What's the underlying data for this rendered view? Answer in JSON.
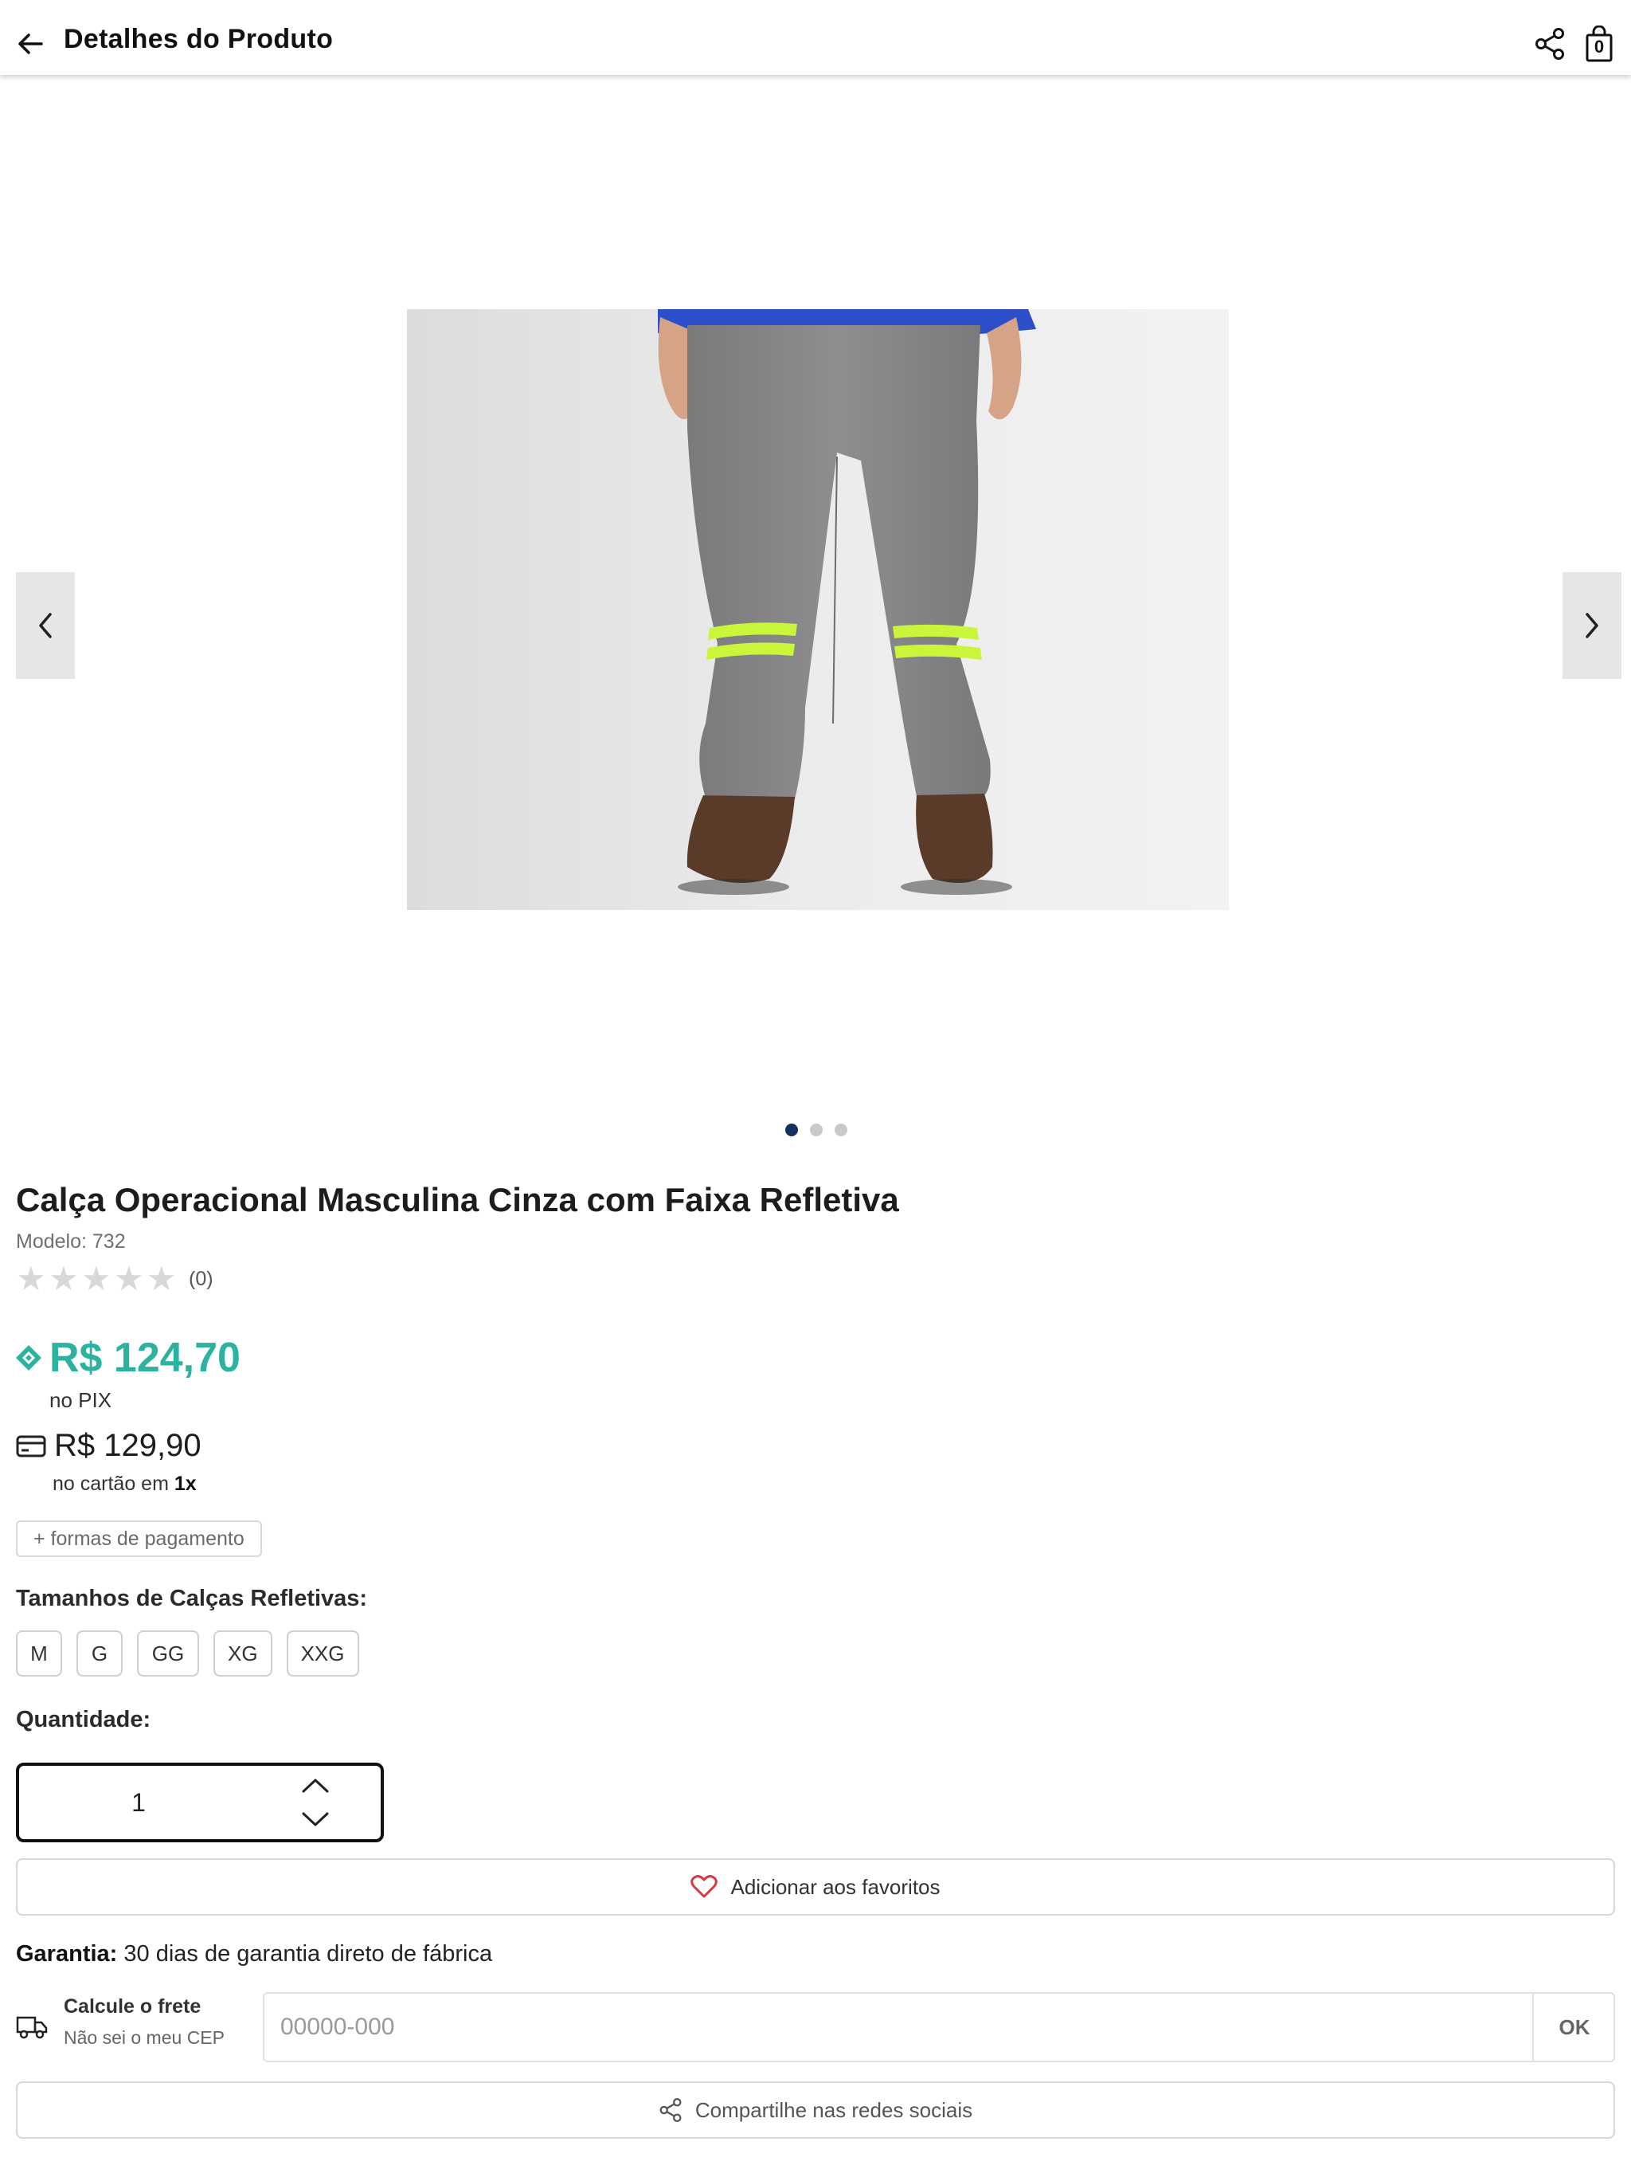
{
  "header": {
    "title": "Detalhes do Produto",
    "cart_count": "0"
  },
  "gallery": {
    "image_alt": "Calça Operacional Masculina Cinza com Faixa Refletiva",
    "dot_count": 3,
    "active_dot": 1
  },
  "product": {
    "title": "Calça Operacional Masculina Cinza com Faixa Refletiva",
    "model": "Modelo: 732",
    "rating_stars": 0,
    "rating_count": "(0)"
  },
  "pricing": {
    "pix_price": "R$ 124,70",
    "pix_label": "no PIX",
    "card_price": "R$ 129,90",
    "card_label_prefix": "no cartão em ",
    "card_installments": "1x",
    "payment_methods_label": "+ formas de pagamento"
  },
  "sizes": {
    "title": "Tamanhos de Calças Refletivas:",
    "options": [
      "M",
      "G",
      "GG",
      "XG",
      "XXG"
    ]
  },
  "quantity": {
    "title": "Quantidade:",
    "value": "1"
  },
  "favorites": {
    "label": "Adicionar aos favoritos"
  },
  "warranty": {
    "label": "Garantia:",
    "text": " 30 dias de garantia direto de fábrica"
  },
  "shipping": {
    "title": "Calcule o frete",
    "link": "Não sei o meu CEP",
    "placeholder": "00000-000",
    "ok_label": "OK"
  },
  "social": {
    "label": "Compartilhe nas redes sociais"
  },
  "colors": {
    "pix_green": "#2bb3a0",
    "active_dot": "#12315e",
    "heart_red": "#d9363e"
  }
}
